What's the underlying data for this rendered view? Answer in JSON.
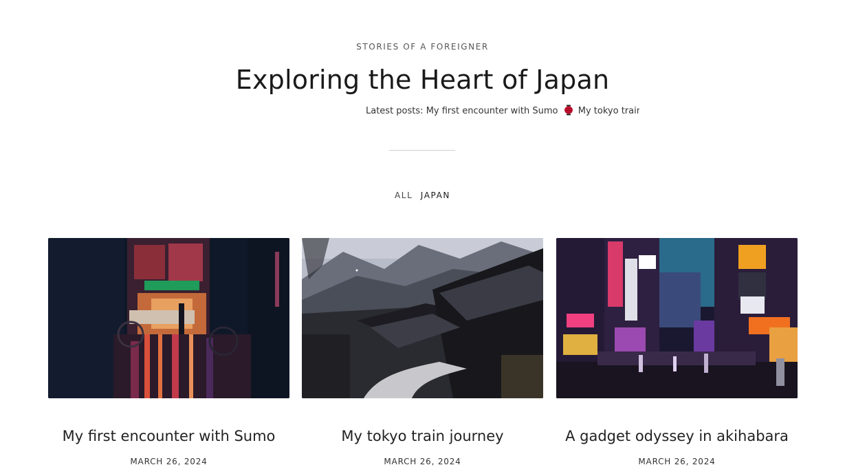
{
  "header": {
    "eyebrow": "STORIES OF A FOREIGNER",
    "title": "Exploring the Heart of Japan",
    "ticker": {
      "prefix": "Latest posts:",
      "items": [
        "My first encounter with Sumo",
        "My tokyo train jou"
      ],
      "separator_icon": "red-lantern-icon"
    }
  },
  "filters": {
    "items": [
      {
        "label": "ALL",
        "active": false
      },
      {
        "label": "JAPAN",
        "active": true
      }
    ]
  },
  "posts": [
    {
      "title": "My first encounter with Sumo",
      "date": "MARCH 26, 2024",
      "image": "rainy-neon-street-night-photo"
    },
    {
      "title": "My tokyo train journey",
      "date": "MARCH 26, 2024",
      "image": "mountain-village-rooftops-photo"
    },
    {
      "title": "A gadget odyssey in akihabara",
      "date": "MARCH 26, 2024",
      "image": "akihabara-neon-street-photo"
    }
  ],
  "colors": {
    "text": "#1a1a1a",
    "muted": "#555555",
    "divider": "#cfcfcf",
    "lantern": "#c8102e"
  }
}
